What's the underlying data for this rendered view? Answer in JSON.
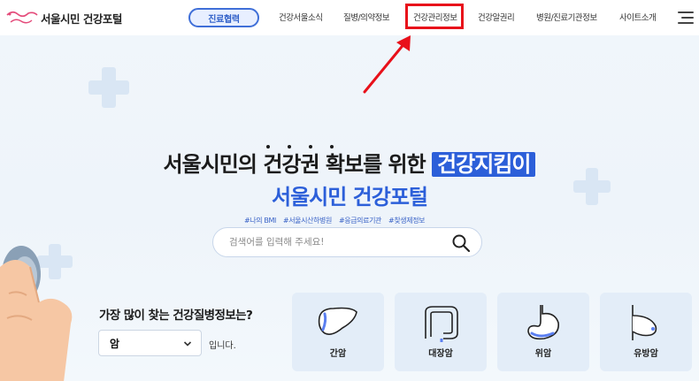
{
  "header": {
    "logo_text": "서울시민 건강포털",
    "nav_pill_label": "진료협력",
    "nav_items": [
      "건강서울소식",
      "질병/의약정보",
      "건강관리정보",
      "건강알권리",
      "병원/진료기관정보",
      "사이트소개"
    ]
  },
  "hero": {
    "line1_part1": "서울시민의 ",
    "line1_dotted": "건강권",
    "line1_part2": " 확보를 위한 ",
    "line1_highlight": "건강지킴이",
    "line2": "서울시민 건강포털"
  },
  "tags": [
    "#나의 BMI",
    "#서울시산하병원",
    "#응급의료기관",
    "#찾생제정보"
  ],
  "search": {
    "placeholder": "검색어를 입력해 주세요!"
  },
  "popular": {
    "question": "가장 많이 찾는 건강질병정보는?",
    "selected": "암",
    "suffix": "입니다.",
    "cards": [
      "간암",
      "대장암",
      "위암",
      "유방암"
    ]
  },
  "colors": {
    "accent": "#2c5fd9",
    "highlight_box": "#e8101a",
    "card_bg": "#e3edf8"
  }
}
